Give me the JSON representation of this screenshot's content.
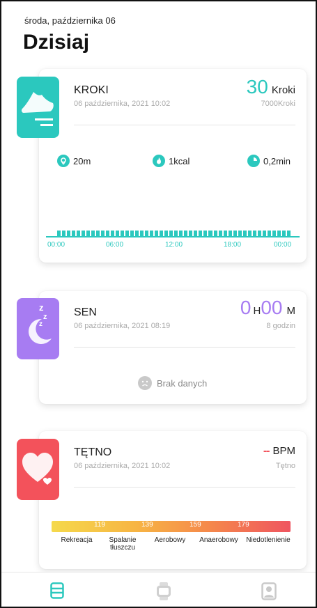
{
  "header": {
    "date": "środa, października 06",
    "title": "Dzisiaj"
  },
  "steps": {
    "title": "KROKI",
    "date": "06 października, 2021 10:02",
    "value": "30",
    "unit": "Kroki",
    "goal": "7000Kroki",
    "distance": "20m",
    "calories": "1kcal",
    "duration": "0,2min",
    "time_labels": [
      "00:00",
      "06:00",
      "12:00",
      "18:00",
      "00:00"
    ],
    "accent": "#2bc8be"
  },
  "sleep": {
    "title": "SEN",
    "date": "06 października, 2021 08:19",
    "hours_value": "0",
    "hours_unit": "H",
    "minutes_value": "00",
    "minutes_unit": "M",
    "goal": "8 godzin",
    "empty_text": "Brak danych",
    "accent": "#a77cf2"
  },
  "heart": {
    "title": "TĘTNO",
    "date": "06 października, 2021 10:02",
    "value": "--",
    "unit": "BPM",
    "sub": "Tętno",
    "thresholds": [
      "119",
      "139",
      "159",
      "179"
    ],
    "zones": [
      "Rekreacja",
      "Spalanie tłuszczu",
      "Aerobowy",
      "Anaerobowy",
      "Niedotlenienie"
    ],
    "accent": "#f3525b"
  },
  "nav": {
    "items": [
      "today-icon",
      "watch-icon",
      "profile-icon"
    ]
  }
}
